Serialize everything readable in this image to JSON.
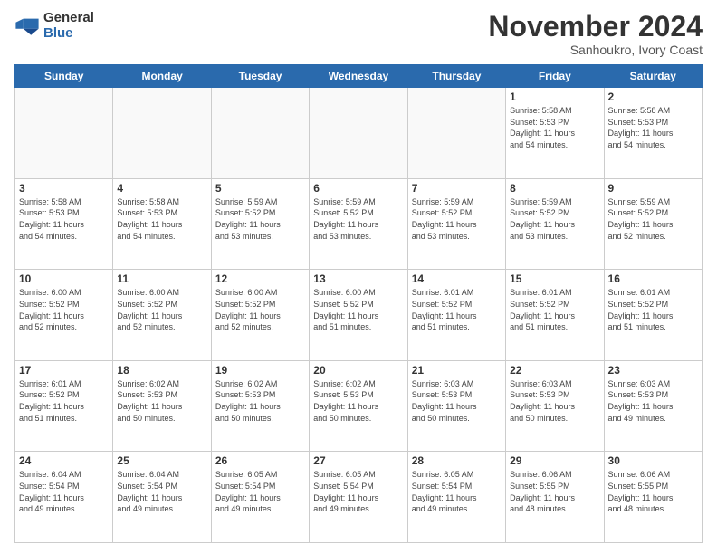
{
  "logo": {
    "general": "General",
    "blue": "Blue"
  },
  "title": "November 2024",
  "subtitle": "Sanhoukro, Ivory Coast",
  "weekdays": [
    "Sunday",
    "Monday",
    "Tuesday",
    "Wednesday",
    "Thursday",
    "Friday",
    "Saturday"
  ],
  "weeks": [
    [
      {
        "day": "",
        "info": ""
      },
      {
        "day": "",
        "info": ""
      },
      {
        "day": "",
        "info": ""
      },
      {
        "day": "",
        "info": ""
      },
      {
        "day": "",
        "info": ""
      },
      {
        "day": "1",
        "info": "Sunrise: 5:58 AM\nSunset: 5:53 PM\nDaylight: 11 hours\nand 54 minutes."
      },
      {
        "day": "2",
        "info": "Sunrise: 5:58 AM\nSunset: 5:53 PM\nDaylight: 11 hours\nand 54 minutes."
      }
    ],
    [
      {
        "day": "3",
        "info": "Sunrise: 5:58 AM\nSunset: 5:53 PM\nDaylight: 11 hours\nand 54 minutes."
      },
      {
        "day": "4",
        "info": "Sunrise: 5:58 AM\nSunset: 5:53 PM\nDaylight: 11 hours\nand 54 minutes."
      },
      {
        "day": "5",
        "info": "Sunrise: 5:59 AM\nSunset: 5:52 PM\nDaylight: 11 hours\nand 53 minutes."
      },
      {
        "day": "6",
        "info": "Sunrise: 5:59 AM\nSunset: 5:52 PM\nDaylight: 11 hours\nand 53 minutes."
      },
      {
        "day": "7",
        "info": "Sunrise: 5:59 AM\nSunset: 5:52 PM\nDaylight: 11 hours\nand 53 minutes."
      },
      {
        "day": "8",
        "info": "Sunrise: 5:59 AM\nSunset: 5:52 PM\nDaylight: 11 hours\nand 53 minutes."
      },
      {
        "day": "9",
        "info": "Sunrise: 5:59 AM\nSunset: 5:52 PM\nDaylight: 11 hours\nand 52 minutes."
      }
    ],
    [
      {
        "day": "10",
        "info": "Sunrise: 6:00 AM\nSunset: 5:52 PM\nDaylight: 11 hours\nand 52 minutes."
      },
      {
        "day": "11",
        "info": "Sunrise: 6:00 AM\nSunset: 5:52 PM\nDaylight: 11 hours\nand 52 minutes."
      },
      {
        "day": "12",
        "info": "Sunrise: 6:00 AM\nSunset: 5:52 PM\nDaylight: 11 hours\nand 52 minutes."
      },
      {
        "day": "13",
        "info": "Sunrise: 6:00 AM\nSunset: 5:52 PM\nDaylight: 11 hours\nand 51 minutes."
      },
      {
        "day": "14",
        "info": "Sunrise: 6:01 AM\nSunset: 5:52 PM\nDaylight: 11 hours\nand 51 minutes."
      },
      {
        "day": "15",
        "info": "Sunrise: 6:01 AM\nSunset: 5:52 PM\nDaylight: 11 hours\nand 51 minutes."
      },
      {
        "day": "16",
        "info": "Sunrise: 6:01 AM\nSunset: 5:52 PM\nDaylight: 11 hours\nand 51 minutes."
      }
    ],
    [
      {
        "day": "17",
        "info": "Sunrise: 6:01 AM\nSunset: 5:52 PM\nDaylight: 11 hours\nand 51 minutes."
      },
      {
        "day": "18",
        "info": "Sunrise: 6:02 AM\nSunset: 5:53 PM\nDaylight: 11 hours\nand 50 minutes."
      },
      {
        "day": "19",
        "info": "Sunrise: 6:02 AM\nSunset: 5:53 PM\nDaylight: 11 hours\nand 50 minutes."
      },
      {
        "day": "20",
        "info": "Sunrise: 6:02 AM\nSunset: 5:53 PM\nDaylight: 11 hours\nand 50 minutes."
      },
      {
        "day": "21",
        "info": "Sunrise: 6:03 AM\nSunset: 5:53 PM\nDaylight: 11 hours\nand 50 minutes."
      },
      {
        "day": "22",
        "info": "Sunrise: 6:03 AM\nSunset: 5:53 PM\nDaylight: 11 hours\nand 50 minutes."
      },
      {
        "day": "23",
        "info": "Sunrise: 6:03 AM\nSunset: 5:53 PM\nDaylight: 11 hours\nand 49 minutes."
      }
    ],
    [
      {
        "day": "24",
        "info": "Sunrise: 6:04 AM\nSunset: 5:54 PM\nDaylight: 11 hours\nand 49 minutes."
      },
      {
        "day": "25",
        "info": "Sunrise: 6:04 AM\nSunset: 5:54 PM\nDaylight: 11 hours\nand 49 minutes."
      },
      {
        "day": "26",
        "info": "Sunrise: 6:05 AM\nSunset: 5:54 PM\nDaylight: 11 hours\nand 49 minutes."
      },
      {
        "day": "27",
        "info": "Sunrise: 6:05 AM\nSunset: 5:54 PM\nDaylight: 11 hours\nand 49 minutes."
      },
      {
        "day": "28",
        "info": "Sunrise: 6:05 AM\nSunset: 5:54 PM\nDaylight: 11 hours\nand 49 minutes."
      },
      {
        "day": "29",
        "info": "Sunrise: 6:06 AM\nSunset: 5:55 PM\nDaylight: 11 hours\nand 48 minutes."
      },
      {
        "day": "30",
        "info": "Sunrise: 6:06 AM\nSunset: 5:55 PM\nDaylight: 11 hours\nand 48 minutes."
      }
    ]
  ]
}
